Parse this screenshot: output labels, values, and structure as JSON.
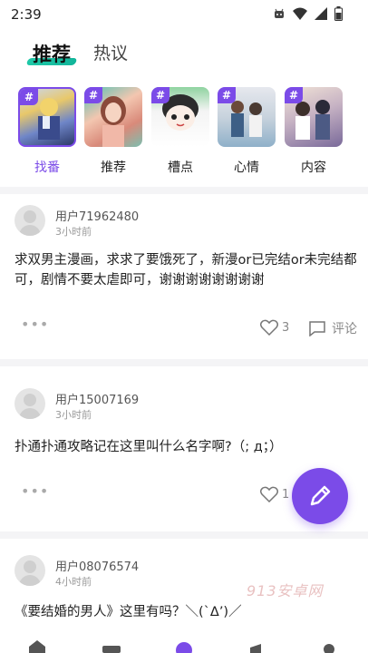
{
  "status_bar": {
    "time": "2:39"
  },
  "tabs": [
    {
      "label": "推荐"
    },
    {
      "label": "热议"
    }
  ],
  "categories": [
    {
      "label": "找番",
      "selected": true
    },
    {
      "label": "推荐",
      "selected": false
    },
    {
      "label": "槽点",
      "selected": false
    },
    {
      "label": "心情",
      "selected": false
    },
    {
      "label": "内容",
      "selected": false
    }
  ],
  "category_badge": "#",
  "posts": [
    {
      "username": "用户71962480",
      "time": "3小时前",
      "content": "求双男主漫画，求求了要饿死了，新漫or已完结or未完结都可，剧情不要太虐即可，谢谢谢谢谢谢谢谢",
      "likes": "3",
      "comment_label": "评论"
    },
    {
      "username": "用户15007169",
      "time": "3小时前",
      "content": "扑通扑通攻略记在这里叫什么名字啊?（;  д；）",
      "likes": "1",
      "comment_label": "论"
    },
    {
      "username": "用户08076574",
      "time": "4小时前",
      "content": "《要结婚的男人》这里有吗？＼(`Δ’)／"
    }
  ],
  "watermark": "913安卓网",
  "colors": {
    "accent": "#7b4be8",
    "tab_underline": "#1fc9a8",
    "divider": "#f4f4f6"
  },
  "icons": {
    "status": [
      "android-notification-icon",
      "wifi-icon",
      "signal-icon",
      "battery-icon"
    ],
    "fab": "pencil-icon",
    "nav": [
      "home-icon",
      "list-icon",
      "center-icon",
      "megaphone-icon",
      "profile-icon"
    ]
  }
}
